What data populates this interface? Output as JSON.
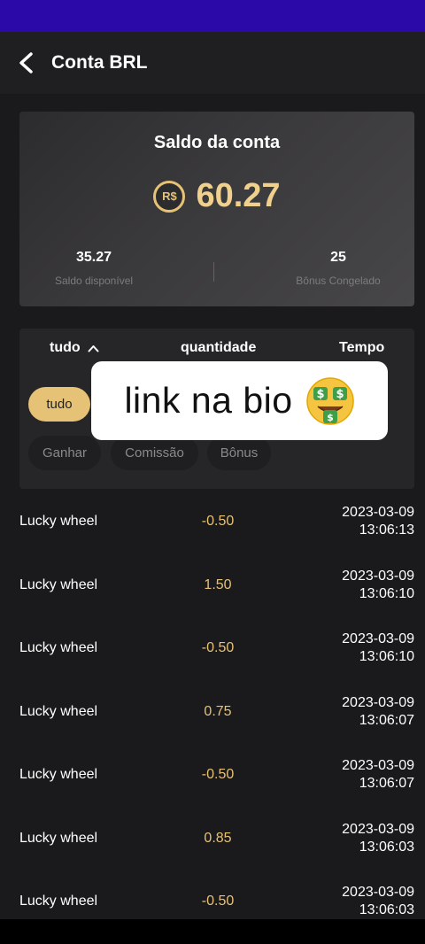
{
  "header": {
    "title": "Conta BRL"
  },
  "balance_card": {
    "title": "Saldo da conta",
    "currency_symbol": "R$",
    "amount": "60.27",
    "available": {
      "value": "35.27",
      "label": "Saldo disponível"
    },
    "frozen_bonus": {
      "value": "25",
      "label": "Bônus Congelado"
    }
  },
  "filter": {
    "columns": {
      "type": "tudo",
      "amount": "quantidade",
      "time": "Tempo"
    },
    "chips": [
      "tudo",
      "Ganhar",
      "Comissão",
      "Bônus"
    ],
    "active_chip": "tudo"
  },
  "overlay": {
    "text": "link na bio"
  },
  "transactions": [
    {
      "name": "Lucky wheel",
      "amount": "-0.50",
      "date": "2023-03-09",
      "time": "13:06:13"
    },
    {
      "name": "Lucky wheel",
      "amount": "1.50",
      "date": "2023-03-09",
      "time": "13:06:10"
    },
    {
      "name": "Lucky wheel",
      "amount": "-0.50",
      "date": "2023-03-09",
      "time": "13:06:10"
    },
    {
      "name": "Lucky wheel",
      "amount": "0.75",
      "date": "2023-03-09",
      "time": "13:06:07"
    },
    {
      "name": "Lucky wheel",
      "amount": "-0.50",
      "date": "2023-03-09",
      "time": "13:06:07"
    },
    {
      "name": "Lucky wheel",
      "amount": "0.85",
      "date": "2023-03-09",
      "time": "13:06:03"
    },
    {
      "name": "Lucky wheel",
      "amount": "-0.50",
      "date": "2023-03-09",
      "time": "13:06:03"
    }
  ],
  "icons": {
    "back": "chevron-left-icon",
    "coin": "coin-icon",
    "sort": "chevron-up-icon",
    "emoji": "money-mouth-face-icon"
  },
  "colors": {
    "accent_gold": "#e6c277",
    "status_bar": "#2b09a8",
    "background": "#1a191b"
  }
}
